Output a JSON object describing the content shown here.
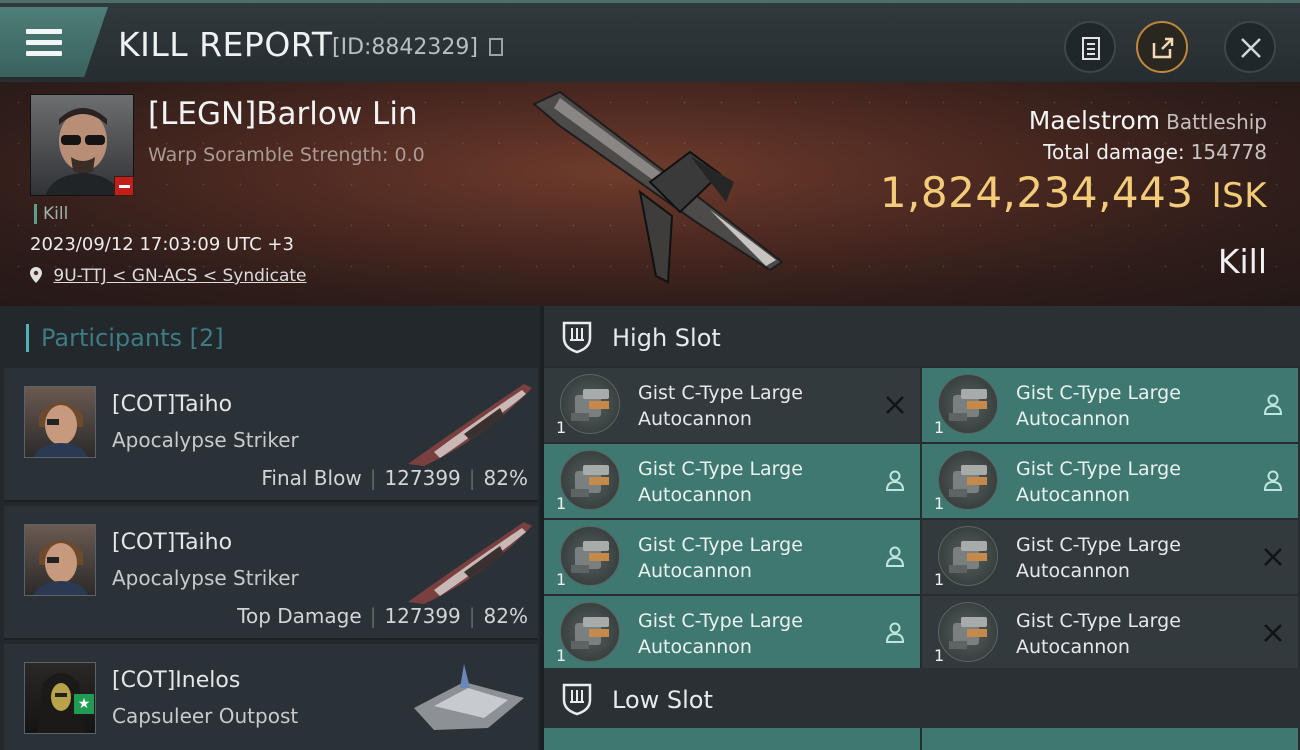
{
  "header": {
    "title": "KILL REPORT",
    "report_id": "[ID:8842329]"
  },
  "victim": {
    "name": "[LEGN]Barlow Lin",
    "scramble": "Warp Soramble Strength: 0.0",
    "kill_tag": "Kill",
    "datetime": "2023/09/12 17:03:09 UTC +3",
    "location": "9U-TTJ < GN-ACS < Syndicate",
    "ship": "Maelstrom",
    "ship_class": "Battleship",
    "total_damage_label": "Total damage:",
    "total_damage": "154778",
    "isk_value": "1,824,234,443",
    "isk_unit": "ISK",
    "result": "Kill"
  },
  "participants": {
    "heading": "Participants",
    "count": "[2]",
    "items": [
      {
        "name": "[COT]Taiho",
        "ship": "Apocalypse Striker",
        "role": "Final Blow",
        "damage": "127399",
        "percent": "82%"
      },
      {
        "name": "[COT]Taiho",
        "ship": "Apocalypse Striker",
        "role": "Top Damage",
        "damage": "127399",
        "percent": "82%"
      },
      {
        "name": "[COT]Inelos",
        "ship": "Capsuleer Outpost"
      }
    ]
  },
  "slots": {
    "high_label": "High Slot",
    "low_label": "Low Slot",
    "modules": [
      {
        "line1": "Gist C-Type Large",
        "line2": "Autocannon",
        "qty": "1",
        "status": "destroyed"
      },
      {
        "line1": "Gist C-Type Large",
        "line2": "Autocannon",
        "qty": "1",
        "status": "dropped"
      },
      {
        "line1": "Gist C-Type Large",
        "line2": "Autocannon",
        "qty": "1",
        "status": "dropped"
      },
      {
        "line1": "Gist C-Type Large",
        "line2": "Autocannon",
        "qty": "1",
        "status": "dropped"
      },
      {
        "line1": "Gist C-Type Large",
        "line2": "Autocannon",
        "qty": "1",
        "status": "dropped"
      },
      {
        "line1": "Gist C-Type Large",
        "line2": "Autocannon",
        "qty": "1",
        "status": "destroyed"
      },
      {
        "line1": "Gist C-Type Large",
        "line2": "Autocannon",
        "qty": "1",
        "status": "dropped"
      },
      {
        "line1": "Gist C-Type Large",
        "line2": "Autocannon",
        "qty": "1",
        "status": "destroyed"
      }
    ]
  },
  "colors": {
    "accent": "#3f7870",
    "isk": "#f3cc7a",
    "corp_badge": "#c41d1d",
    "star_badge": "#1f9c52"
  },
  "icons": [
    "menu-icon",
    "copy-icon",
    "clipboard-icon",
    "share-icon",
    "close-icon",
    "location-pin-icon",
    "shield-slot-icon",
    "destroyed-x-icon",
    "dropped-person-icon",
    "star-icon"
  ]
}
